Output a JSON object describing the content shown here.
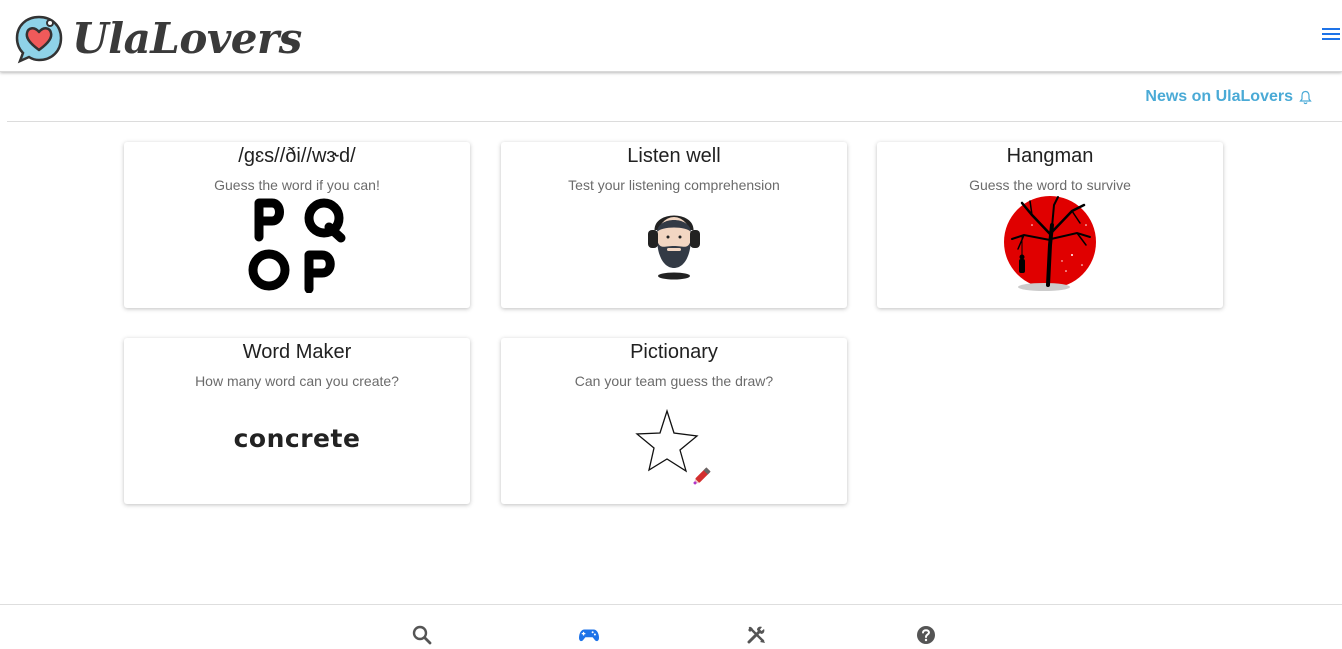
{
  "header": {
    "brand": "UlaLovers",
    "logo_icon": "heart-chat-icon",
    "menu_icon": "hamburger-menu-icon"
  },
  "news": {
    "label": "News on UlaLovers",
    "icon": "bell-icon"
  },
  "games": [
    {
      "title": "/gɛs//ði//wɝd/",
      "subtitle": "Guess the word if you can!",
      "image": "pqop-letters-image"
    },
    {
      "title": "Listen well",
      "subtitle": "Test your listening comprehension",
      "image": "headphones-man-image"
    },
    {
      "title": "Hangman",
      "subtitle": "Guess the word to survive",
      "image": "hangman-tree-image"
    },
    {
      "title": "Word Maker",
      "subtitle": "How many word can you create?",
      "image": "concrete-word-image",
      "image_text": "concrete"
    },
    {
      "title": "Pictionary",
      "subtitle": "Can your team guess the draw?",
      "image": "star-drawing-image"
    }
  ],
  "bottom_nav": [
    {
      "icon": "search-icon",
      "active": false
    },
    {
      "icon": "gamepad-icon",
      "active": true
    },
    {
      "icon": "tools-icon",
      "active": false
    },
    {
      "icon": "help-icon",
      "active": false
    }
  ],
  "colors": {
    "accent_blue": "#1e73e8",
    "news_blue": "#4aaad6",
    "heart_red": "#f05a5a",
    "hangman_red": "#e00000",
    "icon_gray": "#555555"
  }
}
